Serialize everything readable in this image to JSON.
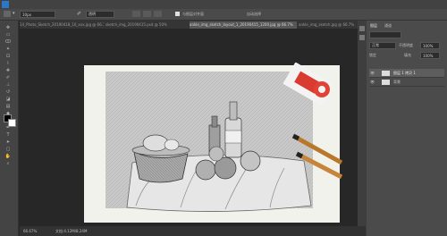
{
  "options": {
    "preset_value": "10px",
    "mode_value": "透明",
    "checkbox_label": "与图层对齐面",
    "right_label": "自动选择"
  },
  "tabs": [
    {
      "label": "14_Photo_Sketch_20190418_10_xxx.jpg @ 66.7% (RGB/8)"
    },
    {
      "label": "sketch_img_20190415.psd @ 50%"
    },
    {
      "label": "ankle_img_sketch_layout_1_20190415_1200.jpg @ 66.7%"
    },
    {
      "label": "ankle_img_sketch.jpg @ 66.7%"
    }
  ],
  "layers_panel": {
    "tab1": "图层",
    "tab2": "通道",
    "blend_mode": "正常",
    "opacity_label": "不透明度",
    "opacity_value": "100%",
    "lock_label": "锁定",
    "fill_label": "填充",
    "fill_value": "100%",
    "layers": [
      {
        "name": "图层 1 拷贝 1",
        "selected": true
      },
      {
        "name": "背景",
        "selected": false
      }
    ]
  },
  "status": {
    "zoom": "66.67%",
    "info": "文档:4.12M/8.24M"
  }
}
